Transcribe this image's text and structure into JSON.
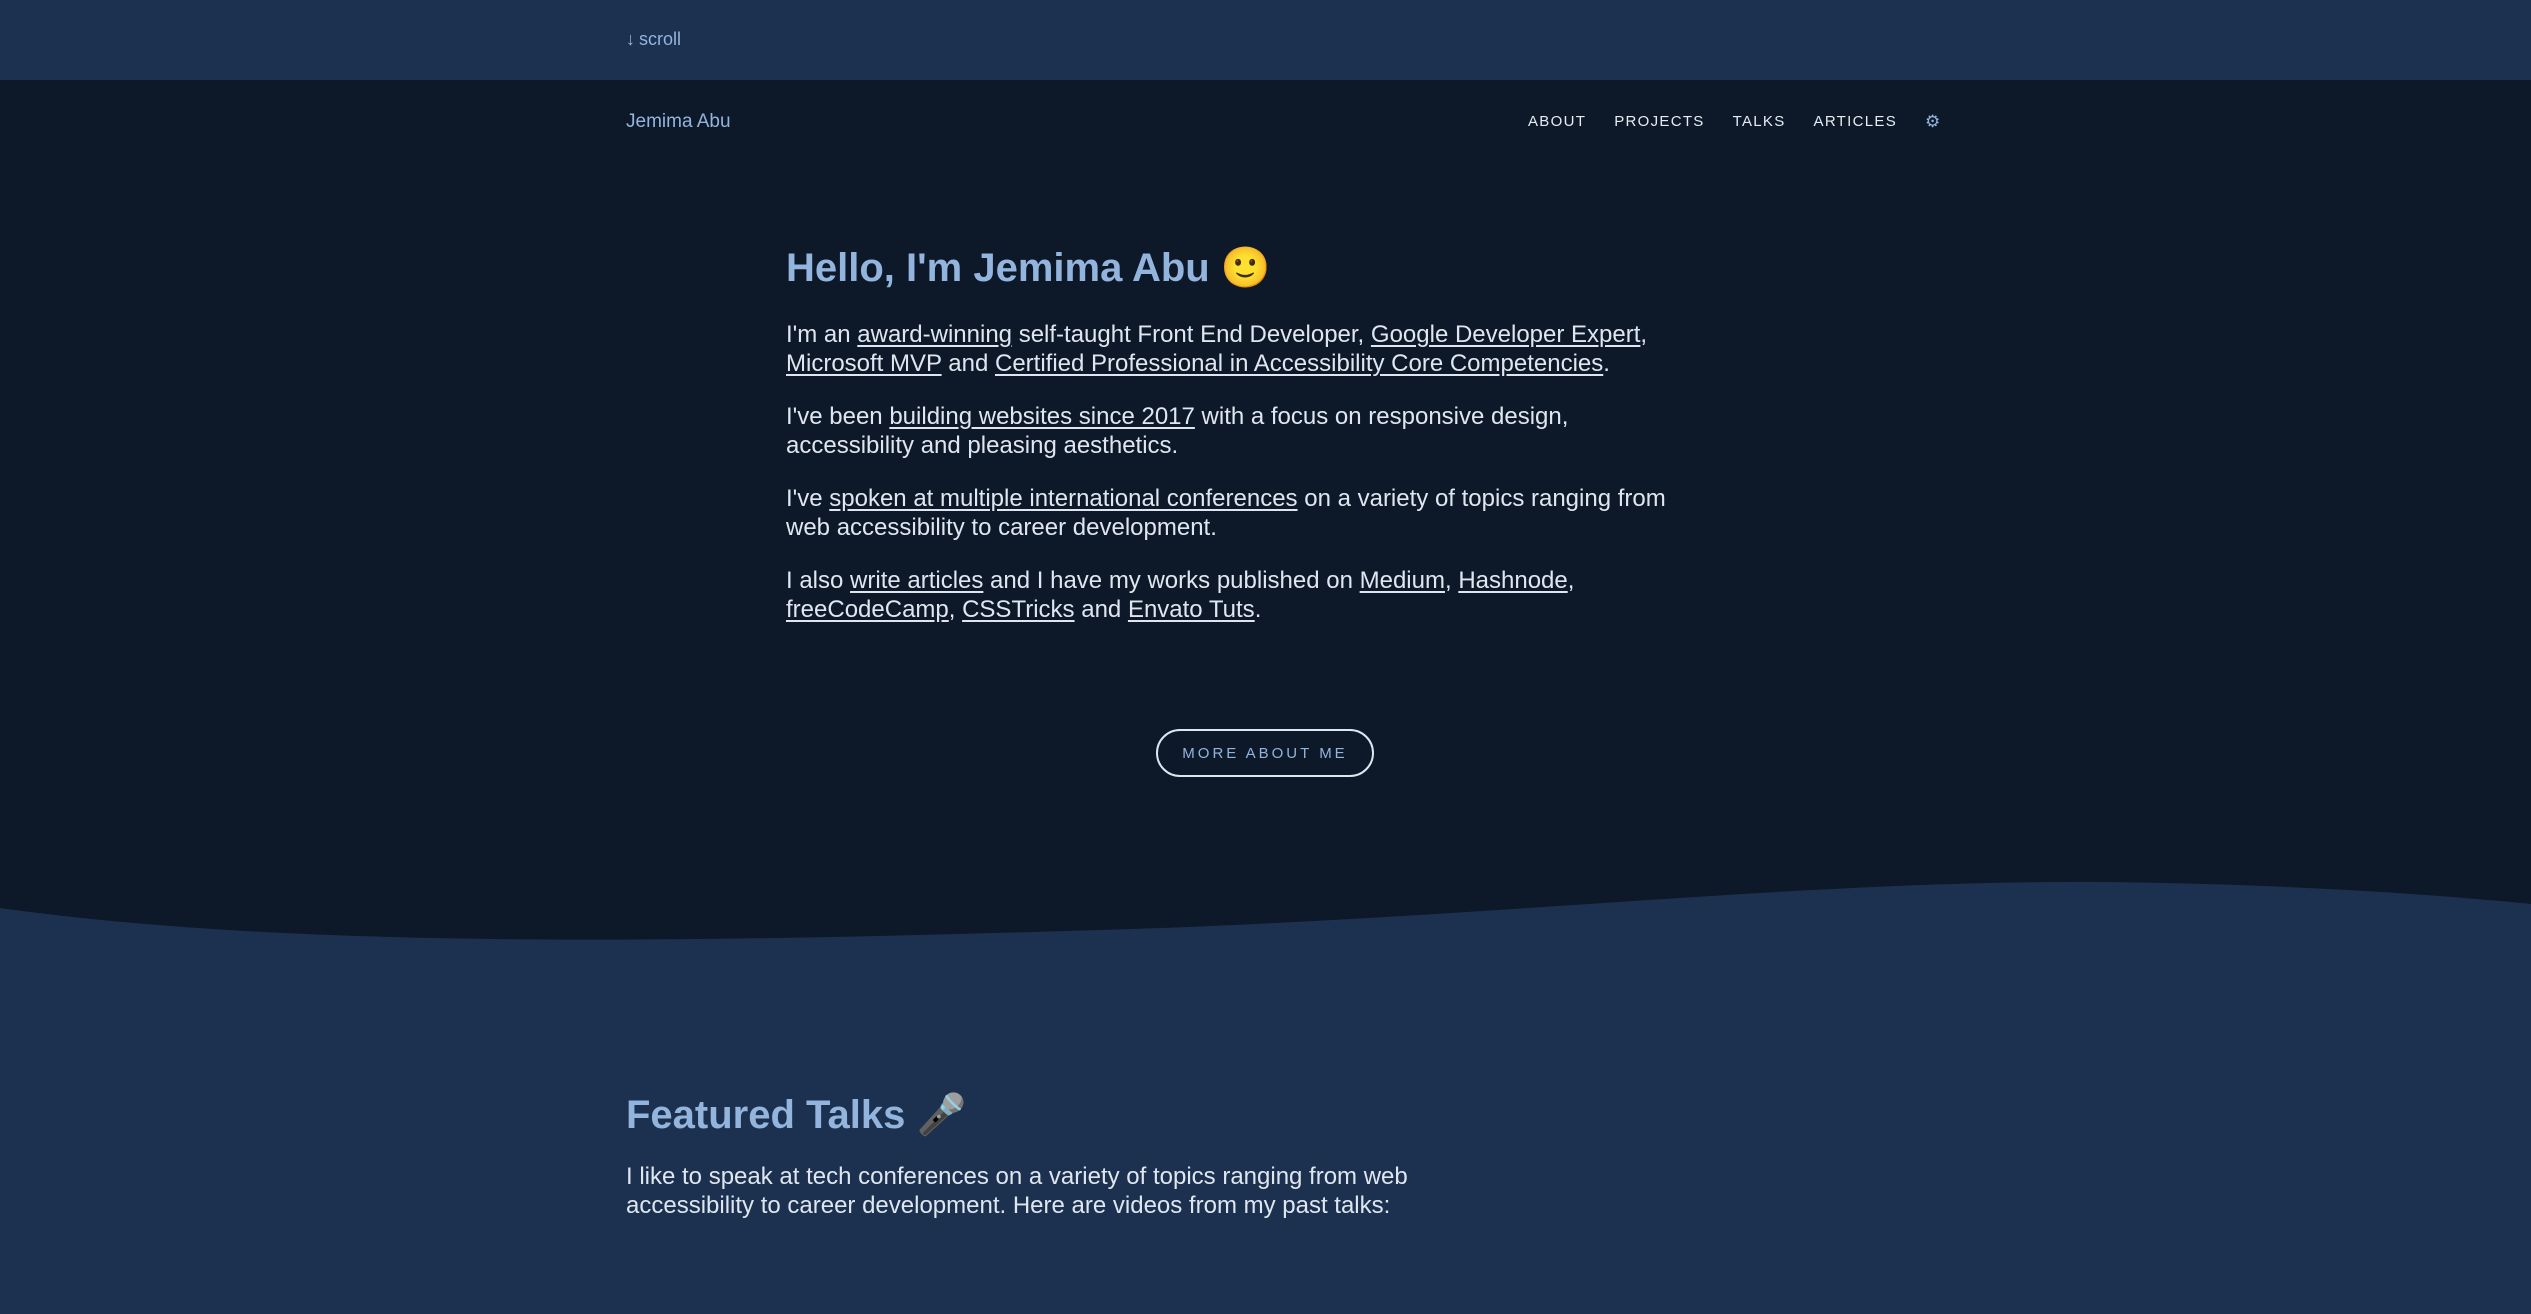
{
  "topbar": {
    "scroll_arrow": "↓",
    "scroll_label": "scroll"
  },
  "header": {
    "brand": "Jemima Abu",
    "nav": [
      "ABOUT",
      "PROJECTS",
      "TALKS",
      "ARTICLES"
    ],
    "theme_icon": "gear-icon"
  },
  "hero": {
    "heading": "Hello, I'm Jemima Abu 🙂",
    "p1": {
      "t0": "I'm an ",
      "l0": "award-winning",
      "t1": " self-taught Front End Developer, ",
      "l1": "Google Developer Expert",
      "t2": ", ",
      "l2": "Microsoft MVP",
      "t3": " and ",
      "l3": "Certified Professional in Accessibility Core Competencies",
      "t4": "."
    },
    "p2": {
      "t0": "I've been ",
      "l0": "building websites since 2017",
      "t1": " with a focus on responsive design, accessibility and pleasing aesthetics."
    },
    "p3": {
      "t0": "I've ",
      "l0": "spoken at multiple international conferences",
      "t1": " on a variety of topics ranging from web accessibility to career development."
    },
    "p4": {
      "t0": "I also ",
      "l0": "write articles",
      "t1": " and I have my works published on ",
      "l1": "Medium",
      "t2": ", ",
      "l2": "Hashnode",
      "t3": ", ",
      "l3": "freeCodeCamp",
      "t4": ", ",
      "l4": "CSSTricks",
      "t5": " and ",
      "l5": "Envato Tuts",
      "t6": "."
    },
    "button": "MORE ABOUT ME"
  },
  "talks": {
    "heading": "Featured Talks 🎤",
    "description": "I like to speak at tech conferences on a variety of topics ranging from web accessibility to career development. Here are videos from my past talks:"
  },
  "colors": {
    "page_bg": "#0d1929",
    "band_bg": "#1c3150",
    "accent": "#93b4dc",
    "text": "#dfe6ef"
  }
}
